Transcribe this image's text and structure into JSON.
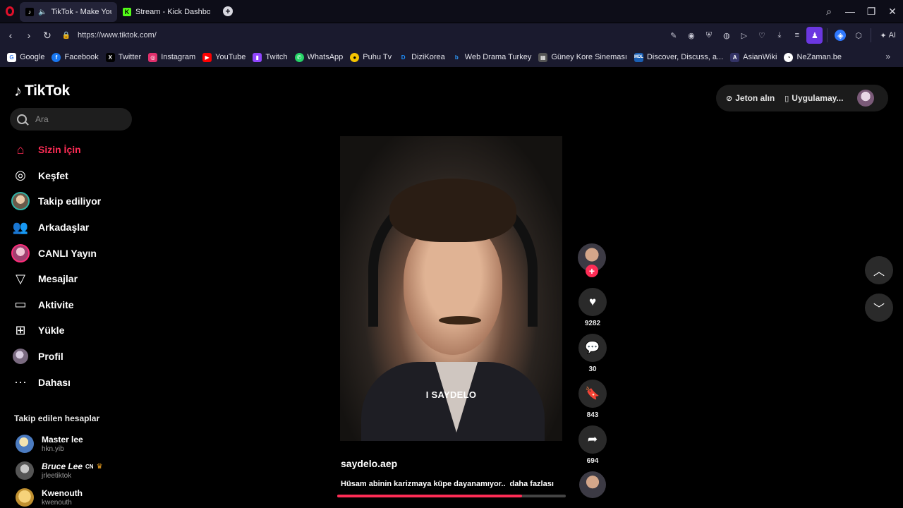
{
  "browser": {
    "tabs": [
      {
        "title": "TikTok - Make Your Da",
        "active": true
      },
      {
        "title": "Stream - Kick Dashboard",
        "active": false
      }
    ],
    "url": "https://www.tiktok.com/",
    "ai_label": "AI",
    "bookmarks": [
      {
        "label": "Google",
        "color": "#ffffff"
      },
      {
        "label": "Facebook",
        "color": "#1877f2"
      },
      {
        "label": "Twitter",
        "color": "#000000"
      },
      {
        "label": "Instagram",
        "color": "#e1306c"
      },
      {
        "label": "YouTube",
        "color": "#ff0000"
      },
      {
        "label": "Twitch",
        "color": "#9146ff"
      },
      {
        "label": "WhatsApp",
        "color": "#25d366"
      },
      {
        "label": "Puhu Tv",
        "color": "#f5c400"
      },
      {
        "label": "DiziKorea",
        "color": "#1e90ff"
      },
      {
        "label": "Web Drama Turkey",
        "color": "#2e9bff"
      },
      {
        "label": "Güney Kore Sineması",
        "color": "#888888"
      },
      {
        "label": "Discover, Discuss, a...",
        "color": "#1a5fb4"
      },
      {
        "label": "AsianWiki",
        "color": "#333366"
      },
      {
        "label": "NeZaman.be",
        "color": "#ffffff"
      }
    ]
  },
  "tiktok": {
    "logo": "TikTok",
    "search_placeholder": "Ara",
    "nav": [
      {
        "label": "Sizin İçin",
        "icon": "home-icon",
        "active": true
      },
      {
        "label": "Keşfet",
        "icon": "compass-icon"
      },
      {
        "label": "Takip ediliyor",
        "icon": "following-avatar-icon"
      },
      {
        "label": "Arkadaşlar",
        "icon": "friends-icon"
      },
      {
        "label": "CANLI Yayın",
        "icon": "live-icon"
      },
      {
        "label": "Mesajlar",
        "icon": "messages-icon"
      },
      {
        "label": "Aktivite",
        "icon": "activity-icon"
      },
      {
        "label": "Yükle",
        "icon": "upload-icon"
      },
      {
        "label": "Profil",
        "icon": "profile-icon"
      },
      {
        "label": "Dahası",
        "icon": "more-icon"
      }
    ],
    "following_title": "Takip edilen hesaplar",
    "following": [
      {
        "name": "Master lee",
        "handle": "hkn.yib"
      },
      {
        "name": "Bruce Lee",
        "badge": "CN",
        "handle": "jrleetiktok"
      },
      {
        "name": "Kwenouth",
        "handle": "kwenouth"
      }
    ],
    "top_right": {
      "coins": "Jeton alın",
      "app": "Uygulamay..."
    },
    "video": {
      "overlay_text": "I   SAYDELO",
      "username": "saydelo.aep",
      "description": "Hüsam abinin karizmaya küpe dayanamıyor..",
      "more": "daha fazlası",
      "progress": 0.81
    },
    "actions": {
      "likes": "9282",
      "comments": "30",
      "saves": "843",
      "shares": "694"
    }
  },
  "colors": {
    "accent": "#fe2c55",
    "chrome_bg": "#1a1a2e"
  }
}
